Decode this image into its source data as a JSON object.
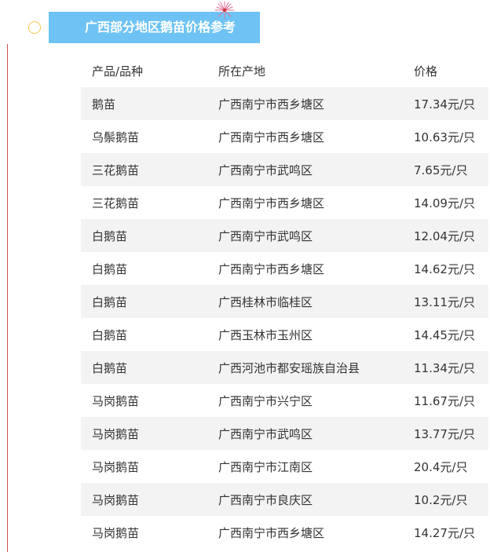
{
  "title": "广西部分地区鹅苗价格参考",
  "columns": [
    "产品/品种",
    "所在产地",
    "价格"
  ],
  "rows": [
    [
      "鹅苗",
      "广西南宁市西乡塘区",
      "17.34元/只"
    ],
    [
      "乌鬃鹅苗",
      "广西南宁市西乡塘区",
      "10.63元/只"
    ],
    [
      "三花鹅苗",
      "广西南宁市武鸣区",
      "7.65元/只"
    ],
    [
      "三花鹅苗",
      "广西南宁市西乡塘区",
      "14.09元/只"
    ],
    [
      "白鹅苗",
      "广西南宁市武鸣区",
      "12.04元/只"
    ],
    [
      "白鹅苗",
      "广西南宁市西乡塘区",
      "14.62元/只"
    ],
    [
      "白鹅苗",
      "广西桂林市临桂区",
      "13.11元/只"
    ],
    [
      "白鹅苗",
      "广西玉林市玉州区",
      "14.45元/只"
    ],
    [
      "白鹅苗",
      "广西河池市都安瑶族自治县",
      "11.34元/只"
    ],
    [
      "马岗鹅苗",
      "广西南宁市兴宁区",
      "11.67元/只"
    ],
    [
      "马岗鹅苗",
      "广西南宁市武鸣区",
      "13.77元/只"
    ],
    [
      "马岗鹅苗",
      "广西南宁市江南区",
      "20.4元/只"
    ],
    [
      "马岗鹅苗",
      "广西南宁市良庆区",
      "10.2元/只"
    ],
    [
      "马岗鹅苗",
      "广西南宁市西乡塘区",
      "14.27元/只"
    ]
  ],
  "colors": {
    "title_bg": "#6ec3f4",
    "row_alt_bg": "#f3f3f3",
    "accent_line": "#d9534f",
    "circle": "#f2c94c"
  }
}
